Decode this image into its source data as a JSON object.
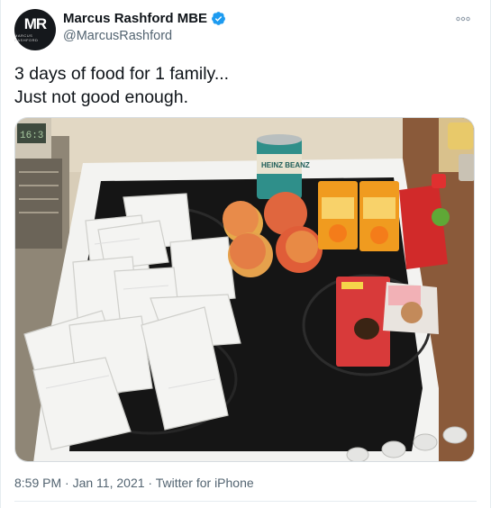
{
  "author": {
    "display_name": "Marcus Rashford MBE",
    "handle": "@MarcusRashford",
    "verified": true,
    "avatar_monogram": "MR",
    "avatar_caption": "MARCUS RASHFORD"
  },
  "tweet": {
    "text_lines": [
      "3 days of food for 1 family...",
      "Just not good enough."
    ],
    "photo_label": "HEINZ BEANZ",
    "photo_oven_display": "16:3"
  },
  "meta": {
    "time": "8:59 PM",
    "separator": " · ",
    "date": "Jan 11, 2021",
    "source": "Twitter for iPhone"
  },
  "icons": {
    "verified": "verified-badge-icon",
    "more": "more-options-icon"
  },
  "colors": {
    "verified_blue": "#1d9bf0",
    "muted_text": "#536471",
    "primary_text": "#0f1419",
    "divider": "#e6ecf0"
  }
}
